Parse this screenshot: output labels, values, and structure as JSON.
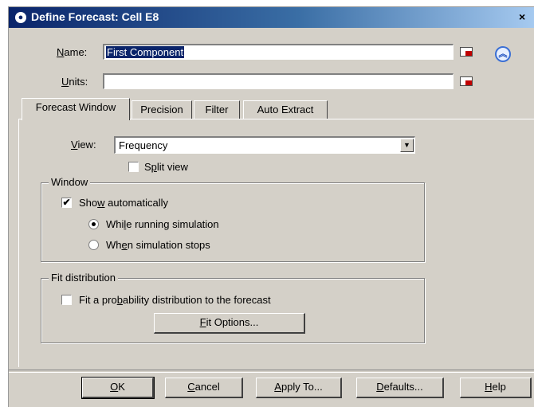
{
  "window": {
    "title": "Define Forecast: Cell E8",
    "close_glyph": "×"
  },
  "name_field": {
    "label_pre": "",
    "label_ul": "N",
    "label_post": "ame:",
    "value": "First Component"
  },
  "units_field": {
    "label_pre": "",
    "label_ul": "U",
    "label_post": "nits:",
    "value": ""
  },
  "tabs": [
    {
      "label": "Forecast Window",
      "active": true
    },
    {
      "label": "Precision",
      "active": false
    },
    {
      "label": "Filter",
      "active": false
    },
    {
      "label": "Auto Extract",
      "active": false
    }
  ],
  "view": {
    "label_pre": "",
    "label_ul": "V",
    "label_post": "iew:",
    "selected": "Frequency"
  },
  "split_view": {
    "label_pre": "S",
    "label_ul": "p",
    "label_post": "lit view",
    "checked": false
  },
  "window_group": {
    "title": "Window",
    "show_auto": {
      "label_pre": "Sho",
      "label_ul": "w",
      "label_post": " automatically",
      "checked": true
    },
    "while_running": {
      "label_pre": "Whi",
      "label_ul": "l",
      "label_post": "e running simulation",
      "selected": true
    },
    "when_stops": {
      "label_pre": "Wh",
      "label_ul": "e",
      "label_post": "n simulation stops",
      "selected": false
    }
  },
  "fit_group": {
    "title": "Fit distribution",
    "fit_check": {
      "label_pre": "Fit a pro",
      "label_ul": "b",
      "label_post": "ability distribution to the forecast",
      "checked": false
    },
    "fit_options": {
      "label_pre": "",
      "label_ul": "F",
      "label_post": "it Options..."
    }
  },
  "buttons": {
    "ok": {
      "label_pre": "",
      "label_ul": "O",
      "label_post": "K"
    },
    "cancel": {
      "label_pre": "",
      "label_ul": "C",
      "label_post": "ancel"
    },
    "apply_to": {
      "label_pre": "",
      "label_ul": "A",
      "label_post": "pply To..."
    },
    "defaults": {
      "label_pre": "",
      "label_ul": "D",
      "label_post": "efaults..."
    },
    "help": {
      "label_pre": "",
      "label_ul": "H",
      "label_post": "elp"
    }
  },
  "icons": {
    "cell_ref": "cell-reference-icon",
    "collapse": "chevron-up-icon",
    "check_mark": "✔",
    "dropdown_arrow": "▼",
    "collapse_glyph": "︽",
    "app_glyph": "●"
  },
  "colors": {
    "titlebar_start": "#0a246a",
    "titlebar_end": "#a6caf0",
    "dialog_bg": "#d4d0c8",
    "selection": "#0a246a"
  }
}
